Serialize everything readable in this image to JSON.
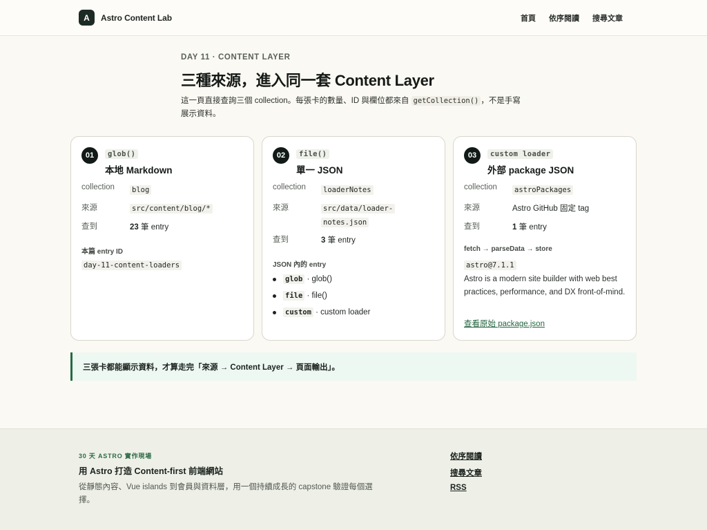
{
  "header": {
    "logo_mark": "A",
    "site_name": "Astro Content Lab",
    "nav": [
      "首頁",
      "依序閱讀",
      "搜尋文章"
    ]
  },
  "intro": {
    "eyebrow": "DAY 11 · CONTENT LAYER",
    "title": "三種來源，進入同一套 Content Layer",
    "lede_before": "這一頁直接查詢三個 collection。每張卡的數量、ID 與欄位都來自 ",
    "lede_code": "getCollection()",
    "lede_after": "，不是手寫展示資料。"
  },
  "labels": {
    "collection": "collection",
    "source": "來源",
    "found": "查到",
    "entry_unit": "筆 entry"
  },
  "cards": [
    {
      "num": "01",
      "tag": "glob()",
      "title": "本地 Markdown",
      "collection": "blog",
      "source_code": "src/content/blog/*",
      "count": "23",
      "sub_label": "本篇 entry ID",
      "entry_id": "day-11-content-loaders"
    },
    {
      "num": "02",
      "tag": "file()",
      "title": "單一 JSON",
      "collection": "loaderNotes",
      "source_code_line1": "src/data/loader-",
      "source_code_line2": "notes.json",
      "count": "3",
      "sub_label": "JSON 內的 entry",
      "entries": [
        {
          "code": "glob",
          "text": "· glob()"
        },
        {
          "code": "file",
          "text": "· file()"
        },
        {
          "code": "custom",
          "text": "· custom loader"
        }
      ]
    },
    {
      "num": "03",
      "tag": "custom loader",
      "title": "外部 package JSON",
      "collection": "astroPackages",
      "source_text": "Astro GitHub 固定 tag",
      "count": "1",
      "sub_label": "fetch → parseData → store",
      "package_version": "astro@7.1.1",
      "package_desc": "Astro is a modern site builder with web best practices, performance, and DX front-of-mind.",
      "link": "查看原始 package.json"
    }
  ],
  "callout": "三張卡都能顯示資料，才算走完「來源 → Content Layer → 頁面輸出」。",
  "footer": {
    "eyebrow": "30 天 ASTRO 實作現場",
    "title": "用 Astro 打造 Content-first 前端網站",
    "desc": "從靜態內容、Vue islands 到會員與資料層，用一個持續成長的 capstone 驗證每個選擇。",
    "links": [
      "依序閱讀",
      "搜尋文章",
      "RSS"
    ]
  },
  "colors": {
    "page_bg": "#fbf9f3",
    "accent_green": "#226b44",
    "callout_bg": "#eef8f3",
    "dark": "#111a16"
  }
}
